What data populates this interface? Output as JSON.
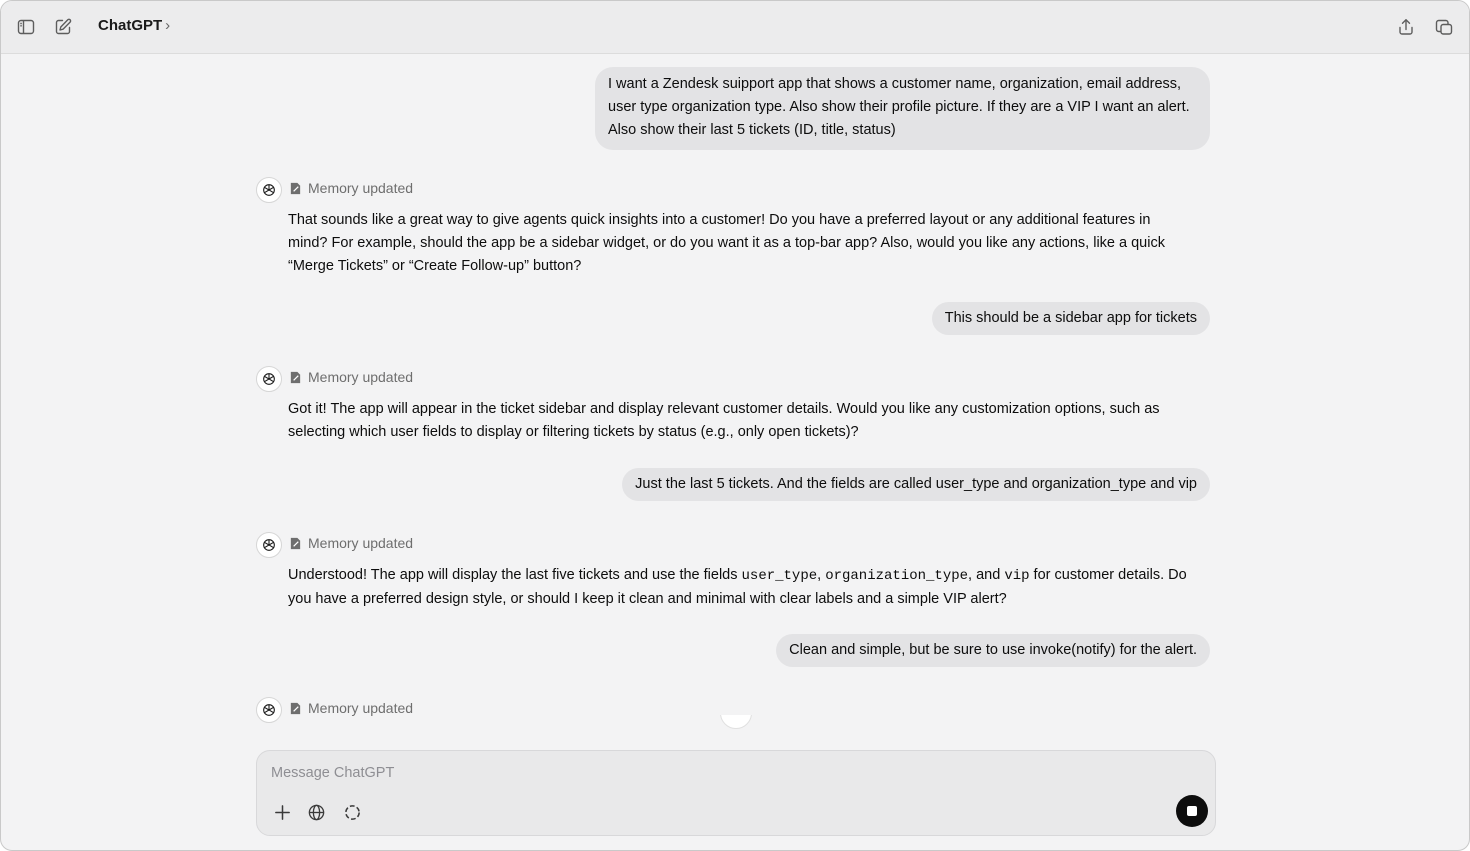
{
  "header": {
    "title": "ChatGPT",
    "chevron": "›",
    "icons": [
      "sidebar-toggle-icon",
      "new-chat-icon",
      "share-icon",
      "new-window-icon"
    ]
  },
  "messages": [
    {
      "role": "user",
      "text": "I want a Zendesk suipport app that shows a customer name, organization, email address, user type organization type. Also show their profile picture. If they are a VIP I want an alert. Also show their last 5 tickets (ID, title, status)"
    },
    {
      "role": "assistant",
      "memory": "Memory updated",
      "text": "That sounds like a great way to give agents quick insights into a customer! Do you have a preferred layout or any additional features in mind? For example, should the app be a sidebar widget, or do you want it as a top-bar app? Also, would you like any actions, like a quick “Merge Tickets” or “Create Follow-up” button?"
    },
    {
      "role": "user",
      "text": "This should be a sidebar app for tickets"
    },
    {
      "role": "assistant",
      "memory": "Memory updated",
      "text": "Got it! The app will appear in the ticket sidebar and display relevant customer details. Would you like any customization options, such as selecting which user fields to display or filtering tickets by status (e.g., only open tickets)?"
    },
    {
      "role": "user",
      "text": "Just the last 5 tickets. And the fields are called user_type and organization_type and vip"
    },
    {
      "role": "assistant",
      "memory": "Memory updated",
      "parts": [
        "Understood! The app will display the last five tickets and use the fields ",
        "user_type",
        ", ",
        "organization_type",
        ", and ",
        "vip",
        " for customer details. Do you have a preferred design style, or should I keep it clean and minimal with clear labels and a simple VIP alert?"
      ]
    },
    {
      "role": "user",
      "text": "Clean and simple, but be sure to use invoke(notify) for the alert."
    },
    {
      "role": "assistant",
      "memory": "Memory updated"
    }
  ],
  "composer": {
    "placeholder": "Message ChatGPT",
    "value": "",
    "tools": [
      "plus-icon",
      "globe-icon",
      "dashed-circle-icon"
    ],
    "stop_button": "stop-icon"
  },
  "colors": {
    "background": "#f3f3f4",
    "user_bubble": "#e3e3e5",
    "topbar": "#ececed",
    "stop_button": "#0d0d0d"
  }
}
